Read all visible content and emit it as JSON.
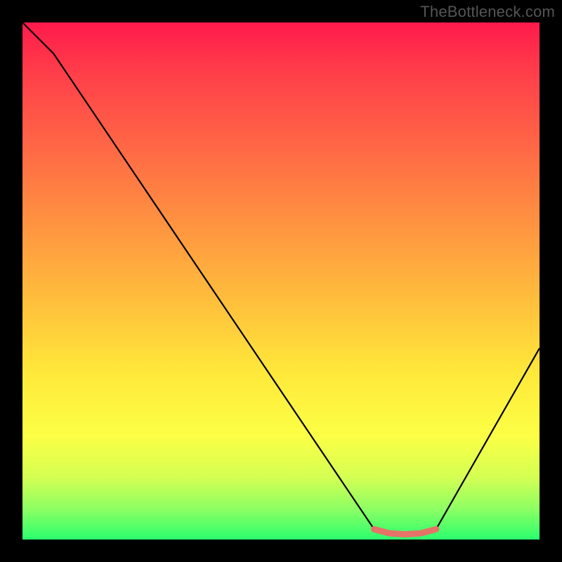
{
  "watermark": "TheBottleneck.com",
  "chart_data": {
    "type": "line",
    "title": "",
    "xlabel": "",
    "ylabel": "",
    "xlim": [
      0,
      100
    ],
    "ylim": [
      0,
      100
    ],
    "x": [
      0,
      6,
      68,
      76,
      80,
      100
    ],
    "values": [
      100,
      94,
      2,
      1,
      2,
      37
    ],
    "highlight": {
      "x": [
        68,
        71,
        74,
        77,
        80
      ],
      "values": [
        2.0,
        1.2,
        1.0,
        1.2,
        2.0
      ]
    },
    "gradient_stops": [
      {
        "pos": 0.0,
        "color": "#ff1a4b"
      },
      {
        "pos": 0.1,
        "color": "#ff3f4a"
      },
      {
        "pos": 0.25,
        "color": "#ff6a45"
      },
      {
        "pos": 0.4,
        "color": "#ff9640"
      },
      {
        "pos": 0.55,
        "color": "#ffc23c"
      },
      {
        "pos": 0.68,
        "color": "#ffe93a"
      },
      {
        "pos": 0.8,
        "color": "#fcff45"
      },
      {
        "pos": 0.88,
        "color": "#d4ff53"
      },
      {
        "pos": 0.94,
        "color": "#8eff63"
      },
      {
        "pos": 1.0,
        "color": "#2bff6e"
      }
    ],
    "colors": {
      "curve": "#000000",
      "highlight": "#e57368",
      "background_frame": "#000000"
    }
  }
}
